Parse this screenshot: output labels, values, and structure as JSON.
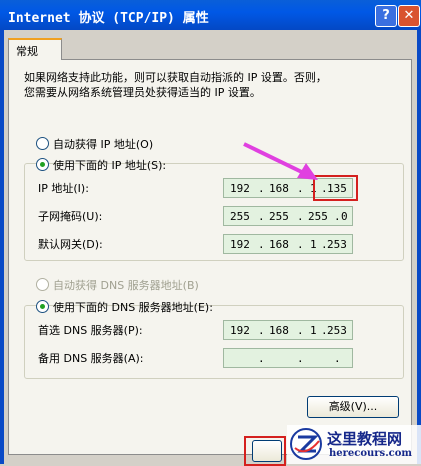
{
  "window": {
    "title": "Internet 协议 (TCP/IP) 属性",
    "help_icon": "question-icon",
    "close_icon": "close-icon"
  },
  "tab": {
    "label": "常规"
  },
  "intro": {
    "line1": "如果网络支持此功能，则可以获取自动指派的 IP 设置。否则，",
    "line2": "您需要从网络系统管理员处获得适当的 IP 设置。"
  },
  "ip_mode": {
    "auto_label": "自动获得 IP 地址(O)",
    "manual_label": "使用下面的 IP 地址(S):",
    "selected": "manual"
  },
  "ip_fields": [
    {
      "label": "IP 地址(I):",
      "octets": [
        "192",
        "168",
        "1",
        "135"
      ]
    },
    {
      "label": "子网掩码(U):",
      "octets": [
        "255",
        "255",
        "255",
        "0"
      ]
    },
    {
      "label": "默认网关(D):",
      "octets": [
        "192",
        "168",
        "1",
        "253"
      ]
    }
  ],
  "dns_mode": {
    "auto_label": "自动获得 DNS 服务器地址(B)",
    "manual_label": "使用下面的 DNS 服务器地址(E):",
    "selected": "manual"
  },
  "dns_fields": [
    {
      "label": "首选 DNS 服务器(P):",
      "octets": [
        "192",
        "168",
        "1",
        "253"
      ]
    },
    {
      "label": "备用 DNS 服务器(A):",
      "octets": [
        "",
        "",
        "",
        ""
      ]
    }
  ],
  "buttons": {
    "advanced": "高级(V)..."
  },
  "annotation": {
    "highlight_color": "#d4201e",
    "arrow_color": "#e040e0"
  },
  "watermark": {
    "site_name": "这里教程网",
    "site_url": "herecours.com"
  }
}
